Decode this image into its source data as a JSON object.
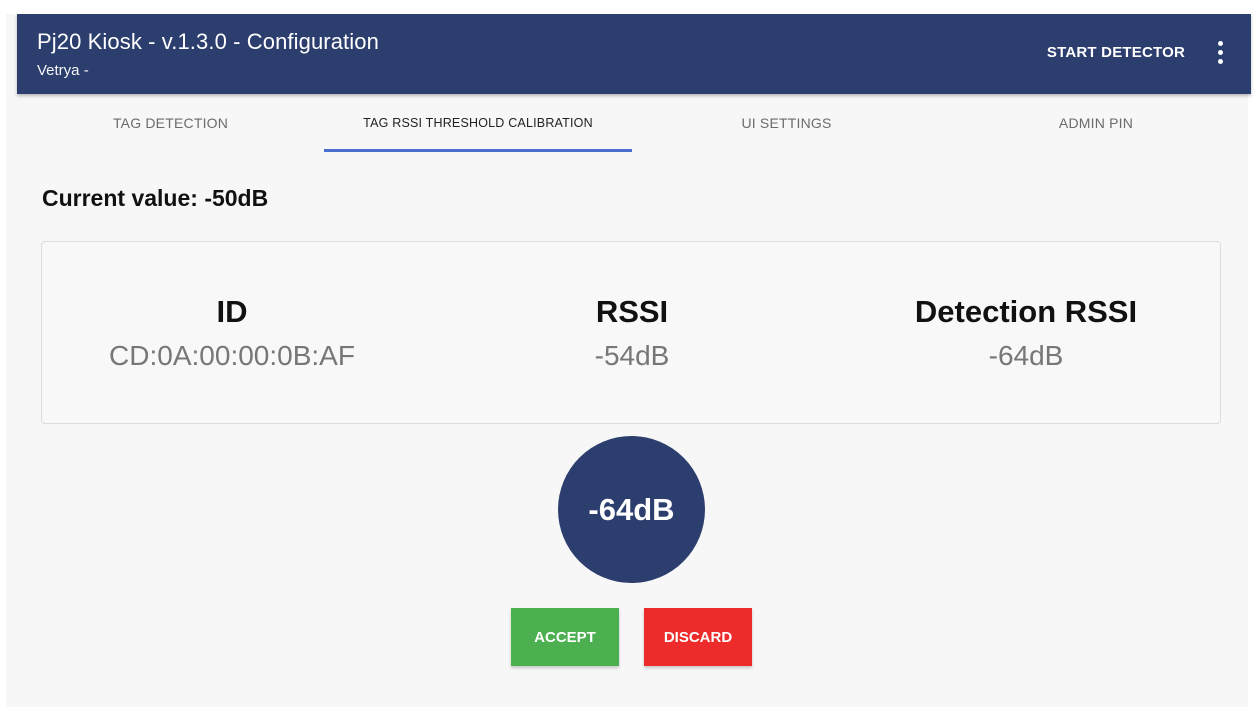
{
  "appbar": {
    "title": "Pj20 Kiosk - v.1.3.0 - Configuration",
    "subtitle": "Vetrya -",
    "start_detector_label": "START DETECTOR",
    "menu_icon": "more-vertical-icon",
    "background_color": "#2c3e6e"
  },
  "tabs": [
    {
      "label": "TAG DETECTION",
      "active": false
    },
    {
      "label": "TAG RSSI THRESHOLD CALIBRATION",
      "active": true
    },
    {
      "label": "UI SETTINGS",
      "active": false
    },
    {
      "label": "ADMIN PIN",
      "active": false
    }
  ],
  "current_value": "Current value: -50dB",
  "readings": {
    "id_header": "ID",
    "id_value": "CD:0A:00:00:0B:AF",
    "rssi_header": "RSSI",
    "rssi_value": "-54dB",
    "detection_header": "Detection RSSI",
    "detection_value": "-64dB"
  },
  "threshold_display": "-64dB",
  "actions": {
    "accept_label": "ACCEPT",
    "accept_color": "#4caf50",
    "discard_label": "DISCARD",
    "discard_color": "#ee2b2b"
  }
}
